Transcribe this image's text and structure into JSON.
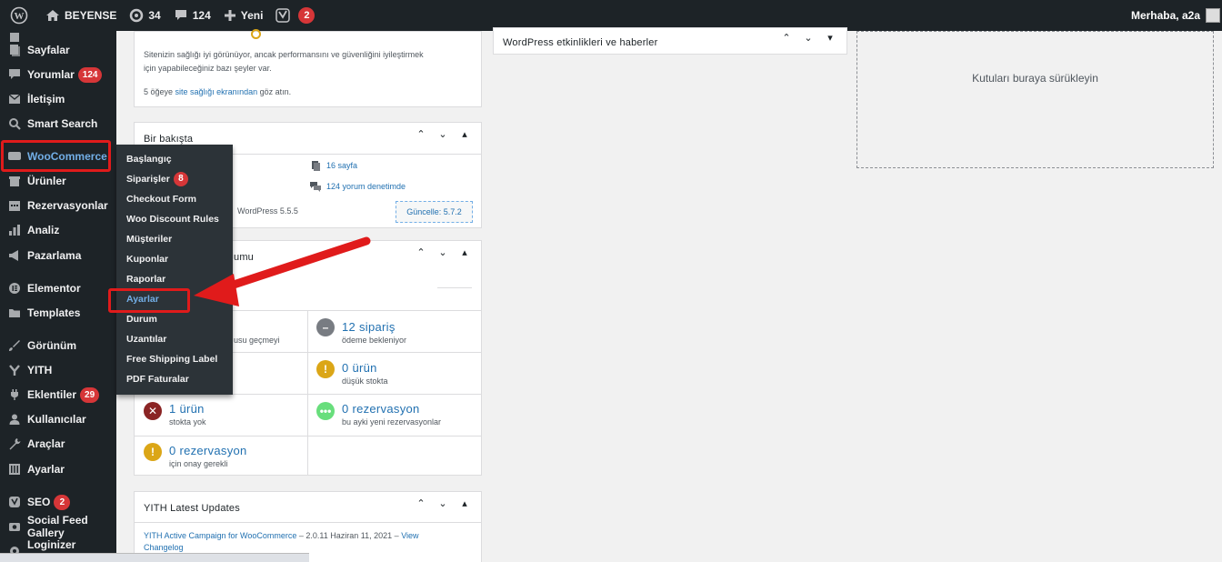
{
  "adminbar": {
    "site_name": "BEYENSE",
    "updates_count": "34",
    "comments_count": "124",
    "new_label": "Yeni",
    "seo_count": "2",
    "greeting": "Merhaba, a2a"
  },
  "sidebar": {
    "items": [
      {
        "label": "Sayfalar"
      },
      {
        "label": "Yorumlar",
        "badge": "124"
      },
      {
        "label": "İletişim"
      },
      {
        "label": "Smart Search"
      },
      {
        "label": "WooCommerce"
      },
      {
        "label": "Ürünler"
      },
      {
        "label": "Rezervasyonlar"
      },
      {
        "label": "Analiz"
      },
      {
        "label": "Pazarlama"
      },
      {
        "label": "Elementor"
      },
      {
        "label": "Templates"
      },
      {
        "label": "Görünüm"
      },
      {
        "label": "YITH"
      },
      {
        "label": "Eklentiler",
        "badge": "29"
      },
      {
        "label": "Kullanıcılar"
      },
      {
        "label": "Araçlar"
      },
      {
        "label": "Ayarlar"
      },
      {
        "label": "SEO",
        "badge": "2"
      },
      {
        "label": "Social Feed Gallery"
      },
      {
        "label": "Loginizer Security"
      }
    ]
  },
  "woo_submenu": {
    "items": [
      {
        "label": "Başlangıç"
      },
      {
        "label": "Siparişler",
        "badge": "8"
      },
      {
        "label": "Checkout Form"
      },
      {
        "label": "Woo Discount Rules"
      },
      {
        "label": "Müşteriler"
      },
      {
        "label": "Kuponlar"
      },
      {
        "label": "Raporlar"
      },
      {
        "label": "Ayarlar"
      },
      {
        "label": "Durum"
      },
      {
        "label": "Uzantılar"
      },
      {
        "label": "Free Shipping Label"
      },
      {
        "label": "PDF Faturalar"
      }
    ]
  },
  "site_health": {
    "line1": "Sitenizin sağlığı iyi görünüyor, ancak performansını ve güvenliğini iyileştirmek",
    "line2": "için yapabileceğiniz bazı şeyler var.",
    "items_prefix": "5 öğeye",
    "items_link": "site sağlığı ekranından",
    "items_suffix": "göz atın."
  },
  "glance": {
    "title": "Bir bakışta",
    "pages": "16 sayfa",
    "comments": "124 yorum denetimde",
    "version_text": "WordPress 5.5.5",
    "update_button": "Güncelle: 5.7.2"
  },
  "woo_status": {
    "title_fragment": "umu",
    "left_partial": "usu geçmeyi",
    "orders_value": "12 sipariş",
    "orders_label": "ödeme bekleniyor",
    "lowstock_value": "0 ürün",
    "lowstock_label": "düşük stokta",
    "outstock_value": "1 ürün",
    "outstock_label": "stokta yok",
    "resv_value": "0 rezervasyon",
    "resv_label": "bu ayki yeni rezervasyonlar",
    "resv_confirm_value": "0 rezervasyon",
    "resv_confirm_label": "için onay gerekli"
  },
  "yith": {
    "title": "YITH Latest Updates",
    "entry_link": "YITH Active Campaign for WooCommerce",
    "entry_version": "2.0.11",
    "entry_date": "Haziran 11, 2021",
    "entry_view": "View",
    "entry_changelog": "Changelog"
  },
  "events": {
    "title": "WordPress etkinlikleri ve haberler"
  },
  "dropzone": {
    "text": "Kutuları buraya sürükleyin"
  },
  "colors": {
    "accent": "#72aee6",
    "highlight_box": "#e01b1b",
    "bubble": "#d63638"
  }
}
